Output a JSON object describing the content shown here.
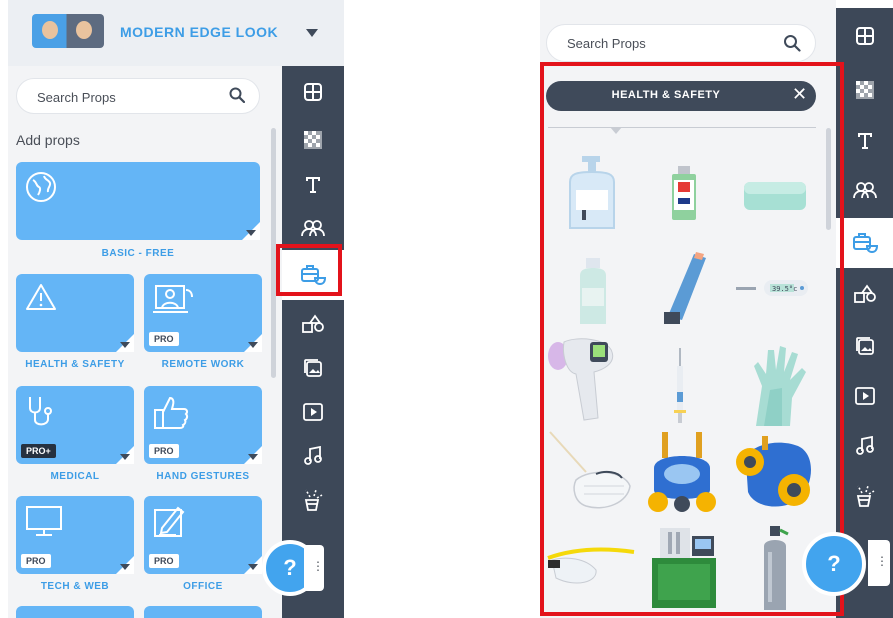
{
  "left": {
    "header_title": "MODERN EDGE LOOK",
    "search_placeholder": "Search Props",
    "add_props_label": "Add props",
    "categories": [
      {
        "label": "BASIC - FREE",
        "badge": ""
      },
      {
        "label": "HEALTH & SAFETY",
        "badge": ""
      },
      {
        "label": "REMOTE WORK",
        "badge": "PRO"
      },
      {
        "label": "MEDICAL",
        "badge": "PRO+"
      },
      {
        "label": "HAND GESTURES",
        "badge": "PRO"
      },
      {
        "label": "TECH & WEB",
        "badge": "PRO"
      },
      {
        "label": "OFFICE",
        "badge": "PRO"
      }
    ],
    "help_label": "?",
    "help_more": "⋮"
  },
  "right": {
    "search_placeholder": "Search Props",
    "category_title": "HEALTH & SAFETY",
    "close_label": "✕",
    "help_label": "?",
    "help_more": "⋮",
    "thermometer_reading": "39.5°c",
    "props": [
      "hand-sanitizer-pump",
      "sanitizer-bottle",
      "soap-bar",
      "medicine-bottle",
      "asthma-inhaler",
      "digital-thermometer",
      "infrared-thermometer",
      "syringe",
      "rubber-gloves",
      "face-mask",
      "gas-mask-blue",
      "gas-mask-yellow",
      "safety-goggles",
      "oxygen-concentrator",
      "oxygen-tank"
    ]
  },
  "sidebar": {
    "items": [
      "layout-icon",
      "background-icon",
      "text-icon",
      "characters-icon",
      "props-icon",
      "shapes-icon",
      "images-icon",
      "video-icon",
      "music-icon",
      "effects-icon"
    ],
    "active": "props-icon"
  },
  "colors": {
    "accent": "#3d9de6",
    "card": "#64b5f6",
    "sidebar": "#3d4858",
    "highlight": "#e3131b"
  }
}
